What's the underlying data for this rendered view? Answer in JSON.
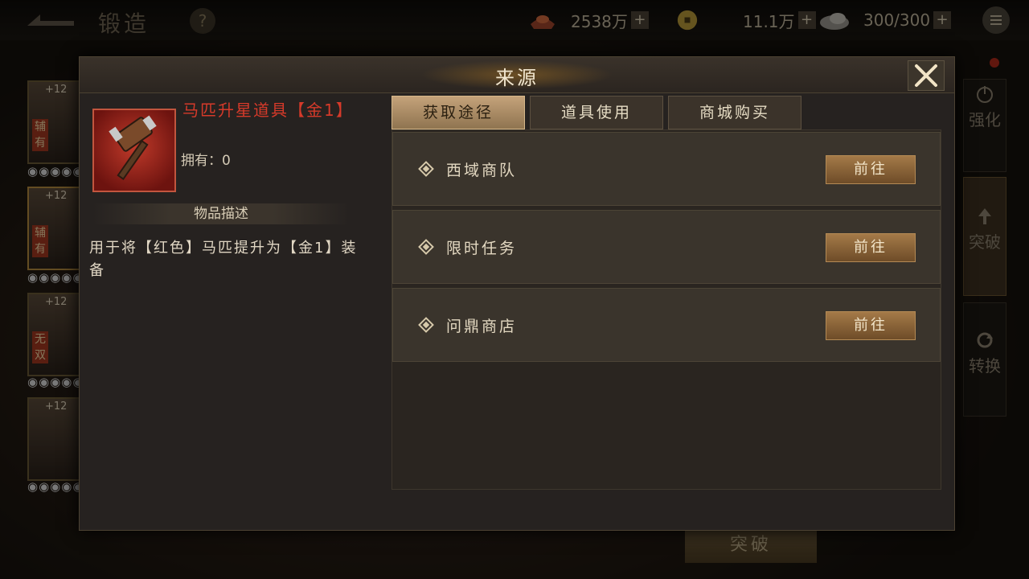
{
  "topbar": {
    "title": "锻造",
    "help": "?",
    "resources": [
      {
        "icon": "ingot-icon",
        "value": "2538万",
        "plus": "+"
      },
      {
        "icon": "coin-icon",
        "value": "11.1万",
        "plus": "+"
      },
      {
        "icon": "stone-icon",
        "value": "300/300",
        "plus": "+"
      }
    ]
  },
  "heroes": [
    {
      "level": "+12",
      "tag": "辅有",
      "dots": "◉◉◉◉◉"
    },
    {
      "level": "+12",
      "tag": "辅有",
      "dots": "◉◉◉◉◉"
    },
    {
      "level": "+12",
      "tag": "无双",
      "dots": "◉◉◉◉◉"
    },
    {
      "level": "+12",
      "tag": "",
      "dots": "◉◉◉◉◉"
    }
  ],
  "side_tabs": [
    {
      "label": "强化",
      "icon": "power-icon"
    },
    {
      "label": "突破",
      "icon": "upgrade-icon"
    },
    {
      "label": "转换",
      "icon": "refresh-icon"
    }
  ],
  "bottom_button": "突破",
  "dialog": {
    "title": "来源",
    "item": {
      "name": "马匹升星道具【金1】",
      "owned": "拥有：0",
      "icon": "hammer-icon"
    },
    "description_header": "物品描述",
    "description": "用于将【红色】马匹提升为【金1】装备",
    "tabs": [
      "获取途径",
      "道具使用",
      "商城购买"
    ],
    "active_tab": 0,
    "sources": [
      {
        "label": "西域商队",
        "button": "前往"
      },
      {
        "label": "限时任务",
        "button": "前往"
      },
      {
        "label": "问鼎商店",
        "button": "前往"
      }
    ]
  },
  "colors": {
    "item_name": "#d63a2a",
    "tab_active": "#c4a27a",
    "go_button": "#a47a48"
  }
}
